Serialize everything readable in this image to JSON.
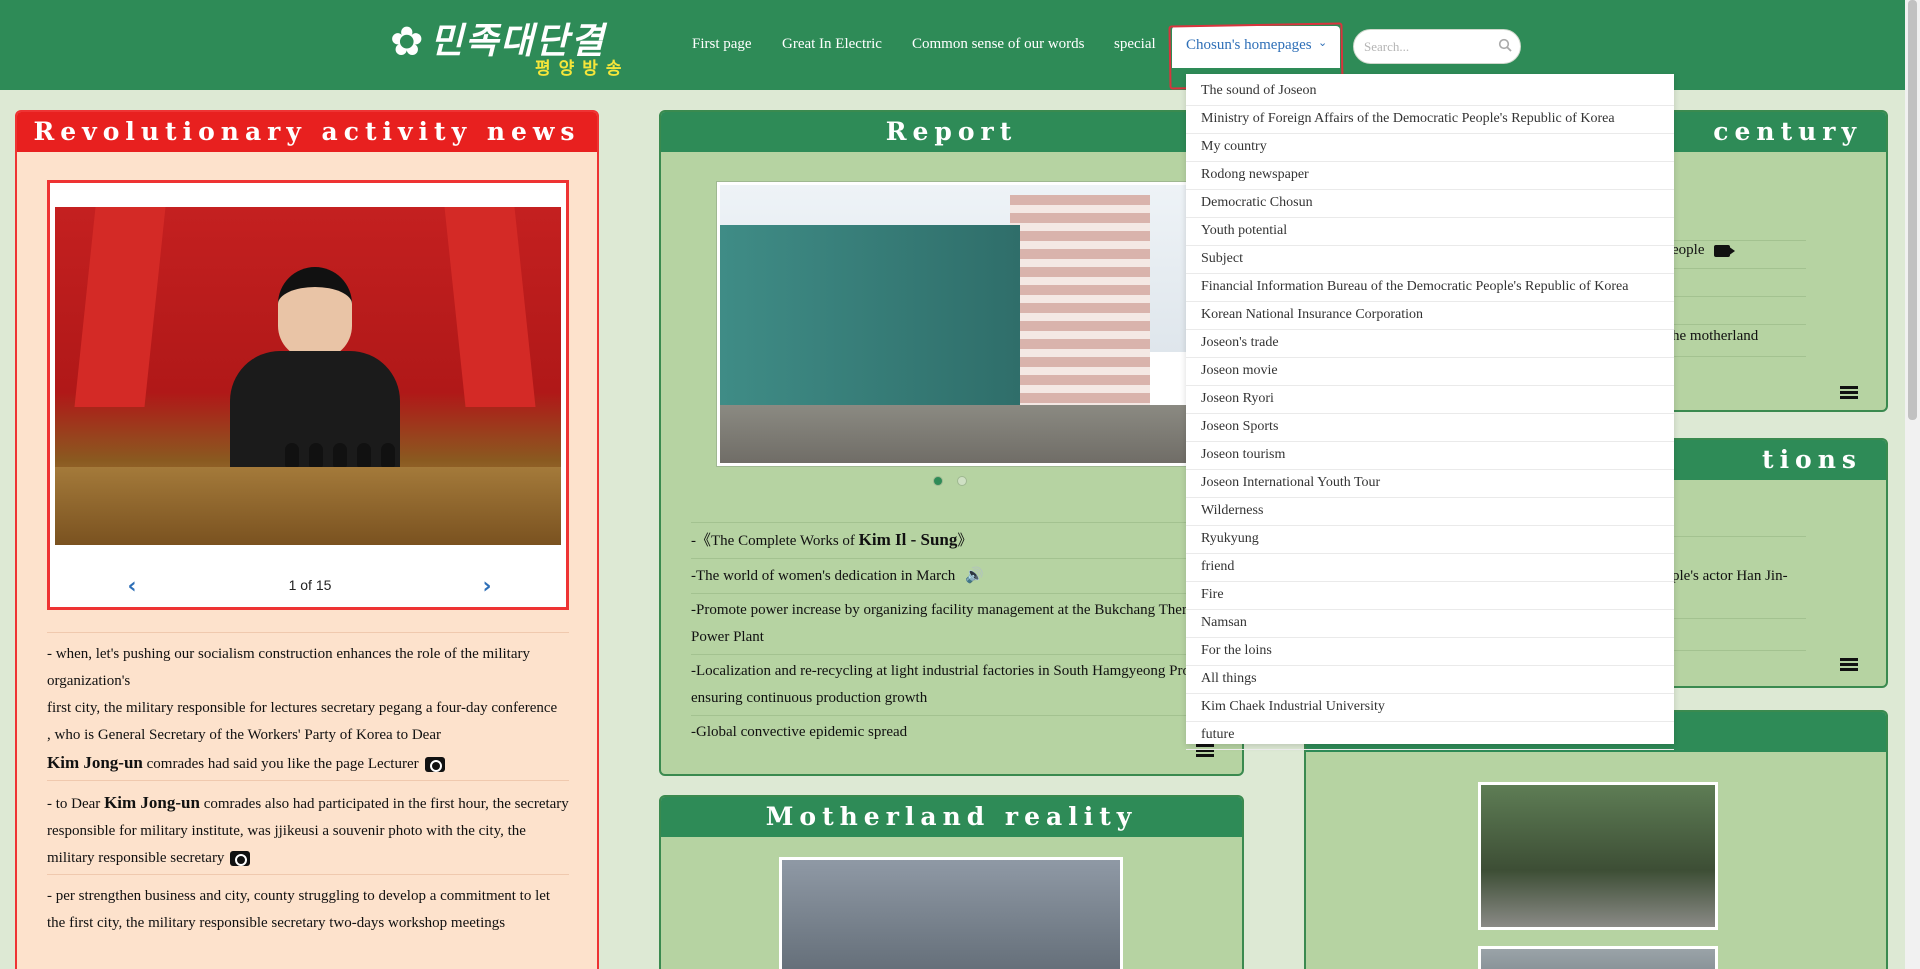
{
  "header": {
    "logo_text": "민족대단결",
    "logo_sub": "평양방송",
    "nav": [
      {
        "label": "First page"
      },
      {
        "label": "Great In Electric"
      },
      {
        "label": "Common sense of our words"
      },
      {
        "label": "special"
      }
    ],
    "active_nav": "Chosun's homepages",
    "search_placeholder": "Search..."
  },
  "left_panel": {
    "title": "Revolutionary activity news",
    "carousel_counter": "1 of 15",
    "news": [
      {
        "text": "- when, let's pushing our socialism construction enhances the role of the military organization's"
      },
      {
        "text": "first city, the military responsible for lectures secretary pegang a four-day conference"
      },
      {
        "text": ", who is General Secretary of the Workers' Party of Korea to Dear"
      },
      {
        "bold": "Kim Jong-un",
        "text": " comrades had said you like the page Lecturer"
      },
      {
        "pre": "-   to Dear ",
        "bold": "Kim Jong-un",
        "text": " comrades also had participated in the first hour, the secretary responsible for military institute, was jjikeusi a souvenir photo with the city, the military responsible secretary"
      },
      {
        "text": "- per strengthen business and city, county struggling to develop a commitment to let"
      },
      {
        "text": "the first city, the military responsible secretary two-days workshop meetings"
      }
    ]
  },
  "mid_panel": {
    "title": "Report",
    "items": [
      {
        "pre": "-《The Complete Works of ",
        "bold": "Kim Il - Sung",
        "post": "》"
      },
      {
        "pre": "-The world of women's dedication in March"
      },
      {
        "pre": "-Promote power increase by organizing facility management at the Bukchang Thermal Power Plant"
      },
      {
        "pre": "-Localization and re-recycling at light industrial factories in South Hamgyeong Province, ensuring continuous production growth"
      },
      {
        "pre": "-Global convective epidemic spread"
      }
    ]
  },
  "mid2_panel": {
    "title": "Motherland reality"
  },
  "right_panels": {
    "top_title": "century",
    "top_items": [
      "eople",
      "he motherland"
    ],
    "mid_title": "tions",
    "mid_items": [
      "ple's actor Han Jin-"
    ]
  },
  "dropdown": {
    "items": [
      "The sound of Joseon",
      "Ministry of Foreign Affairs of the Democratic People's Republic of Korea",
      "My country",
      "Rodong newspaper",
      "Democratic Chosun",
      "Youth potential",
      "Subject",
      "Financial Information Bureau of the Democratic People's Republic of Korea",
      "Korean National Insurance Corporation",
      "Joseon's trade",
      "Joseon movie",
      "Joseon Ryori",
      "Joseon Sports",
      "Joseon tourism",
      "Joseon International Youth Tour",
      "Wilderness",
      "Ryukyung",
      "friend",
      "Fire",
      "Namsan",
      "For the loins",
      "All things",
      "Kim Chaek Industrial University",
      "future"
    ]
  },
  "colors": {
    "header_green": "#2e8b57",
    "accent_red": "#e8201f",
    "link_blue": "#2e6fb7",
    "panel_green": "#b6d3a2",
    "panel_peach": "#fde2cc"
  }
}
